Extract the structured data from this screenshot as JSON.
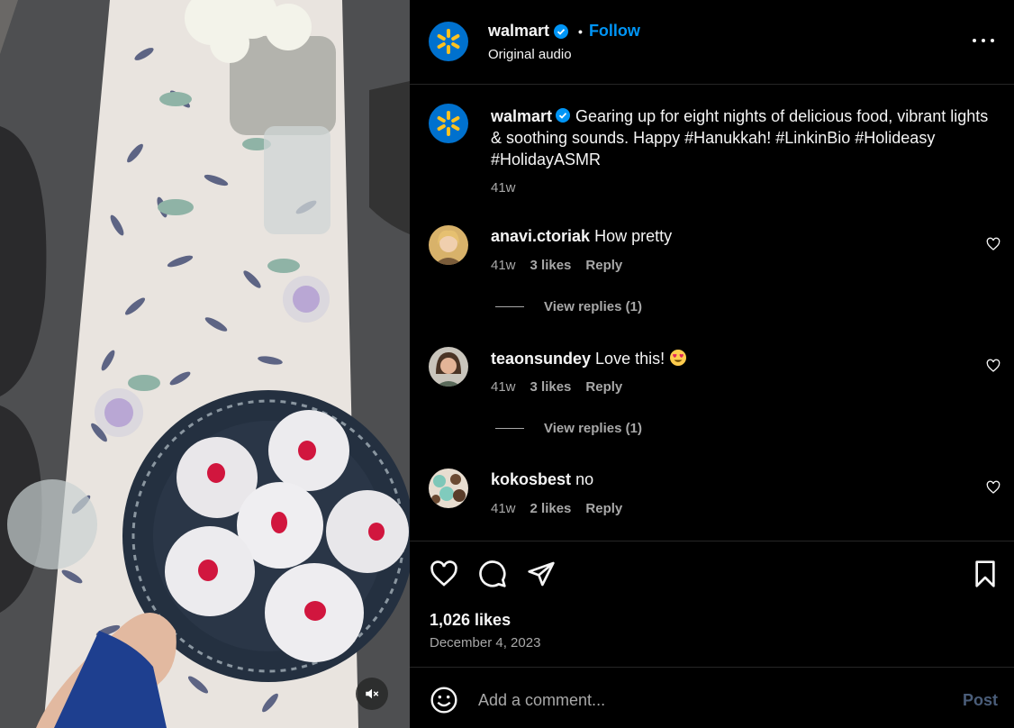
{
  "post": {
    "username": "walmart",
    "follow_label": "Follow",
    "separator": "•",
    "audio": "Original audio"
  },
  "caption": {
    "username": "walmart",
    "text": "Gearing up for eight nights of delicious food, vibrant lights & soothing sounds. Happy #Hanukkah! #LinkinBio #Holideasy #HolidayASMR",
    "time": "41w"
  },
  "comments": [
    {
      "username": "anavi.ctoriak",
      "text": "How pretty",
      "time": "41w",
      "likes": "3 likes",
      "reply_label": "Reply",
      "view_replies": "View replies (1)"
    },
    {
      "username": "teaonsundey",
      "text": "Love this!",
      "emoji": "heart-eyes-emoji",
      "time": "41w",
      "likes": "3 likes",
      "reply_label": "Reply",
      "view_replies": "View replies (1)"
    },
    {
      "username": "kokosbest",
      "text": "no",
      "time": "41w",
      "likes": "2 likes",
      "reply_label": "Reply"
    }
  ],
  "actions": {
    "likes": "1,026 likes",
    "date": "December 4, 2023",
    "icons": [
      "heart-icon",
      "comment-icon",
      "share-icon",
      "bookmark-icon"
    ]
  },
  "comment_box": {
    "placeholder": "Add a comment...",
    "post_label": "Post"
  },
  "colors": {
    "accent": "#0095f6",
    "background": "#000000",
    "walmart_blue": "#0071ce",
    "walmart_yellow": "#ffc220"
  }
}
